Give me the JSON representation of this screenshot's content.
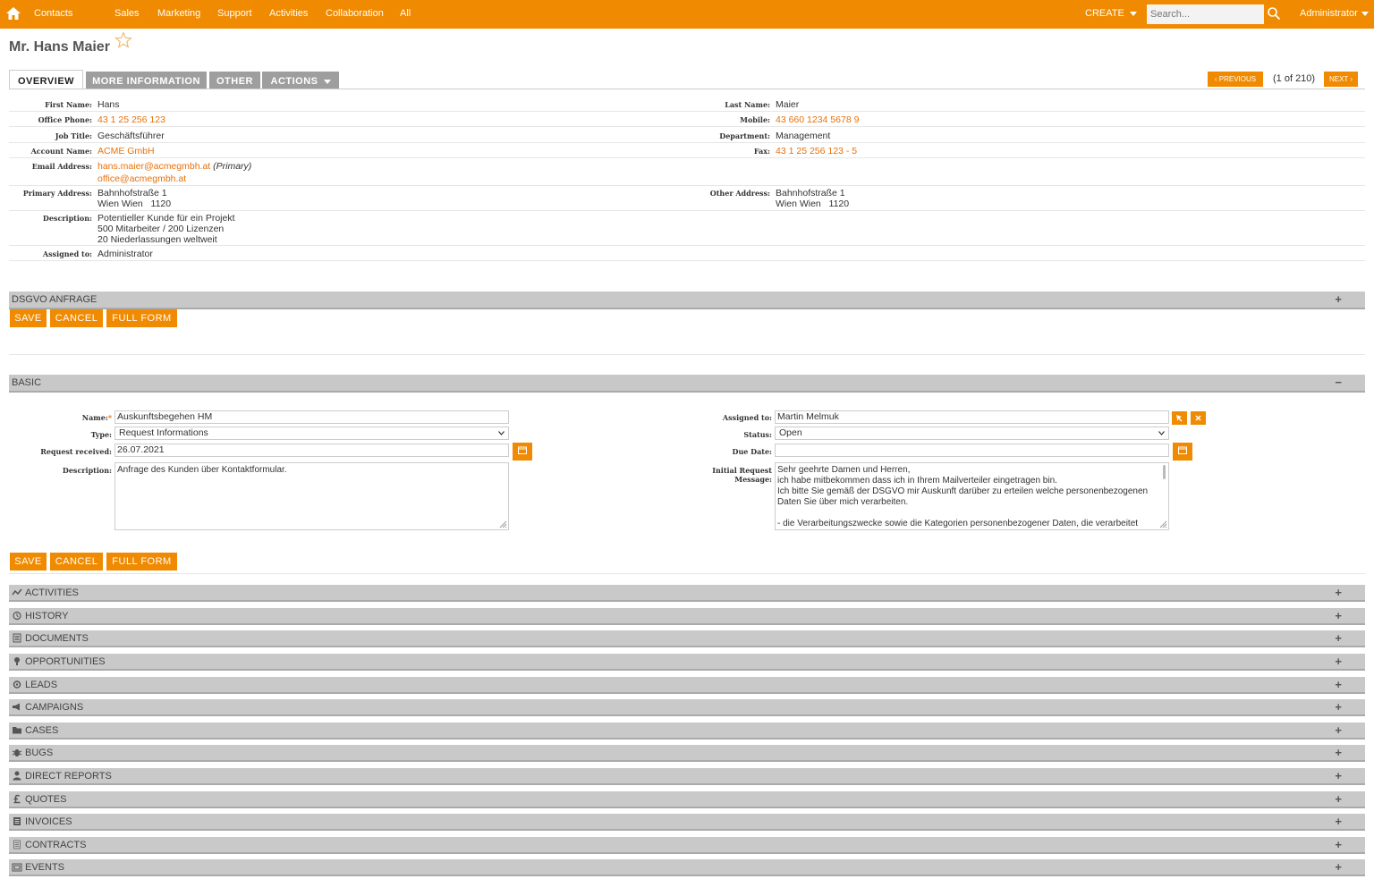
{
  "topbar": {
    "nav": [
      "Contacts",
      "Sales",
      "Marketing",
      "Support",
      "Activities",
      "Collaboration",
      "All"
    ],
    "create": "CREATE",
    "search_placeholder": "Search...",
    "user": "Administrator"
  },
  "record": {
    "title": "Mr. Hans Maier"
  },
  "tabs": [
    "OVERVIEW",
    "MORE INFORMATION",
    "OTHER",
    "ACTIONS"
  ],
  "pager": {
    "previous": "PREVIOUS",
    "count": "(1 of 210)",
    "next": "NEXT"
  },
  "details": {
    "first_name_label": "First Name:",
    "first_name": "Hans",
    "last_name_label": "Last Name:",
    "last_name": "Maier",
    "office_phone_label": "Office Phone:",
    "office_phone": "43 1 25 256 123",
    "mobile_label": "Mobile:",
    "mobile": "43 660 1234 5678 9",
    "job_title_label": "Job Title:",
    "job_title": "Geschäftsführer",
    "department_label": "Department:",
    "department": "Management",
    "account_name_label": "Account Name:",
    "account_name": "ACME GmbH",
    "fax_label": "Fax:",
    "fax": "43 1 25 256 123 - 5",
    "email_label": "Email Address:",
    "email_primary": "hans.maier@acmegmbh.at",
    "email_primary_tag": "(Primary)",
    "email_secondary": "office@acmegmbh.at",
    "primary_address_label": "Primary Address:",
    "primary_address_line1": "Bahnhofstraße 1",
    "primary_address_line2": "Wien Wien   1120",
    "other_address_label": "Other Address:",
    "other_address_line1": "Bahnhofstraße 1",
    "other_address_line2": "Wien Wien   1120",
    "description_label": "Description:",
    "description_lines": [
      "Potentieller Kunde für ein Projekt",
      "500 Mitarbeiter / 200 Lizenzen",
      "20 Niederlassungen weltweit"
    ],
    "assigned_label": "Assigned to:",
    "assigned": "Administrator"
  },
  "dsgvo": {
    "title": "DSGVO ANFRAGE",
    "expand": "+",
    "save": "SAVE",
    "cancel": "CANCEL",
    "full_form": "FULL FORM"
  },
  "basic": {
    "title": "BASIC",
    "collapse": "−",
    "name_label": "Name:",
    "name_required": "*",
    "name": "Auskunftsbegehen HM",
    "type_label": "Type:",
    "type": "Request Informations",
    "request_received_label": "Request received:",
    "request_received": "26.07.2021",
    "description_label": "Description:",
    "description": "Anfrage des Kunden über Kontaktformular.",
    "assigned_label": "Assigned to:",
    "assigned": "Martin Melmuk",
    "status_label": "Status:",
    "status": "Open",
    "due_date_label": "Due Date:",
    "due_date": "",
    "initial_request_label_1": "Initial Request",
    "initial_request_label_2": "Message:",
    "initial_request_lines": [
      "Sehr geehrte Damen und Herren,",
      "ich habe mitbekommen dass ich in Ihrem Mailverteiler eingetragen bin.",
      "Ich bitte Sie gemäß der DSGVO mir Auskunft darüber zu erteilen welche personenbezogenen",
      "Daten Sie über mich verarbeiten.",
      "",
      "- die Verarbeitungszwecke sowie die Kategorien personenbezogener Daten, die verarbeitet"
    ],
    "save": "SAVE",
    "cancel": "CANCEL",
    "full_form": "FULL FORM"
  },
  "subpanels": [
    {
      "title": "ACTIVITIES",
      "icon": "activities-icon",
      "sign": "+"
    },
    {
      "title": "HISTORY",
      "icon": "history-icon",
      "sign": "+"
    },
    {
      "title": "DOCUMENTS",
      "icon": "documents-icon",
      "sign": "+"
    },
    {
      "title": "OPPORTUNITIES",
      "icon": "opportunities-icon",
      "sign": "+"
    },
    {
      "title": "LEADS",
      "icon": "leads-icon",
      "sign": "+"
    },
    {
      "title": "CAMPAIGNS",
      "icon": "campaigns-icon",
      "sign": "+"
    },
    {
      "title": "CASES",
      "icon": "cases-icon",
      "sign": "+"
    },
    {
      "title": "BUGS",
      "icon": "bugs-icon",
      "sign": "+"
    },
    {
      "title": "DIRECT REPORTS",
      "icon": "direct-reports-icon",
      "sign": "+"
    },
    {
      "title": "QUOTES",
      "icon": "quotes-icon",
      "sign": "+"
    },
    {
      "title": "INVOICES",
      "icon": "invoices-icon",
      "sign": "+"
    },
    {
      "title": "CONTRACTS",
      "icon": "contracts-icon",
      "sign": "+"
    },
    {
      "title": "EVENTS",
      "icon": "events-icon",
      "sign": "+"
    }
  ],
  "colors": {
    "accent": "#f08a00",
    "link": "#e8710a",
    "bar": "#c8c8c8"
  }
}
